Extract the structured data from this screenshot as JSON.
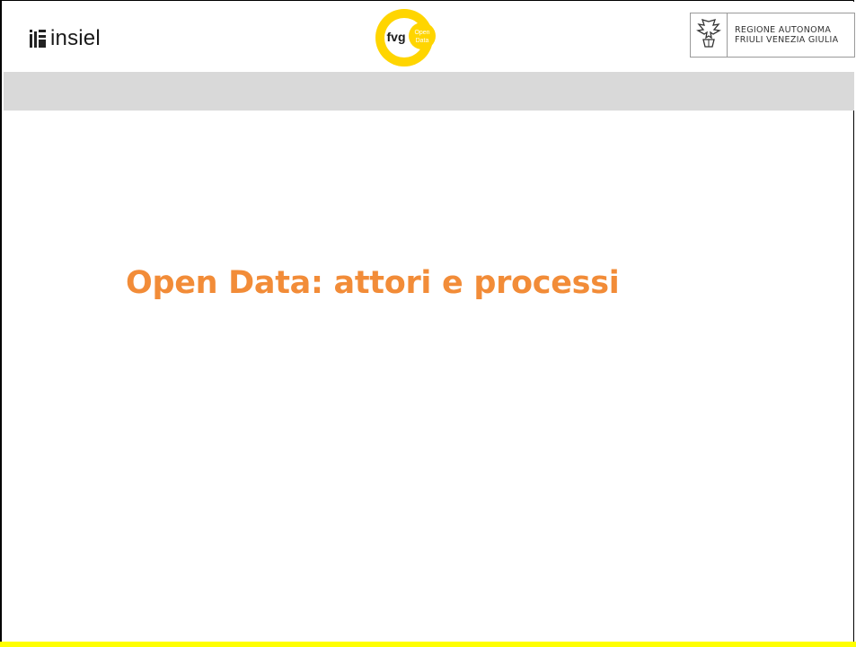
{
  "header": {
    "insiel_logo_text": "insiel",
    "fvg_logo": {
      "main": "fvg",
      "badge_line1": "Open",
      "badge_line2": "Data"
    },
    "regione_logo": {
      "line1": "REGIONE AUTONOMA",
      "line2": "FRIULI VENEZIA GIULIA"
    }
  },
  "slide": {
    "title": "Open Data: attori e processi"
  },
  "colors": {
    "title": "#f28c38",
    "band": "#d9d9d9",
    "fvg_yellow": "#ffd500",
    "bottom_bar": "#ffff00"
  }
}
